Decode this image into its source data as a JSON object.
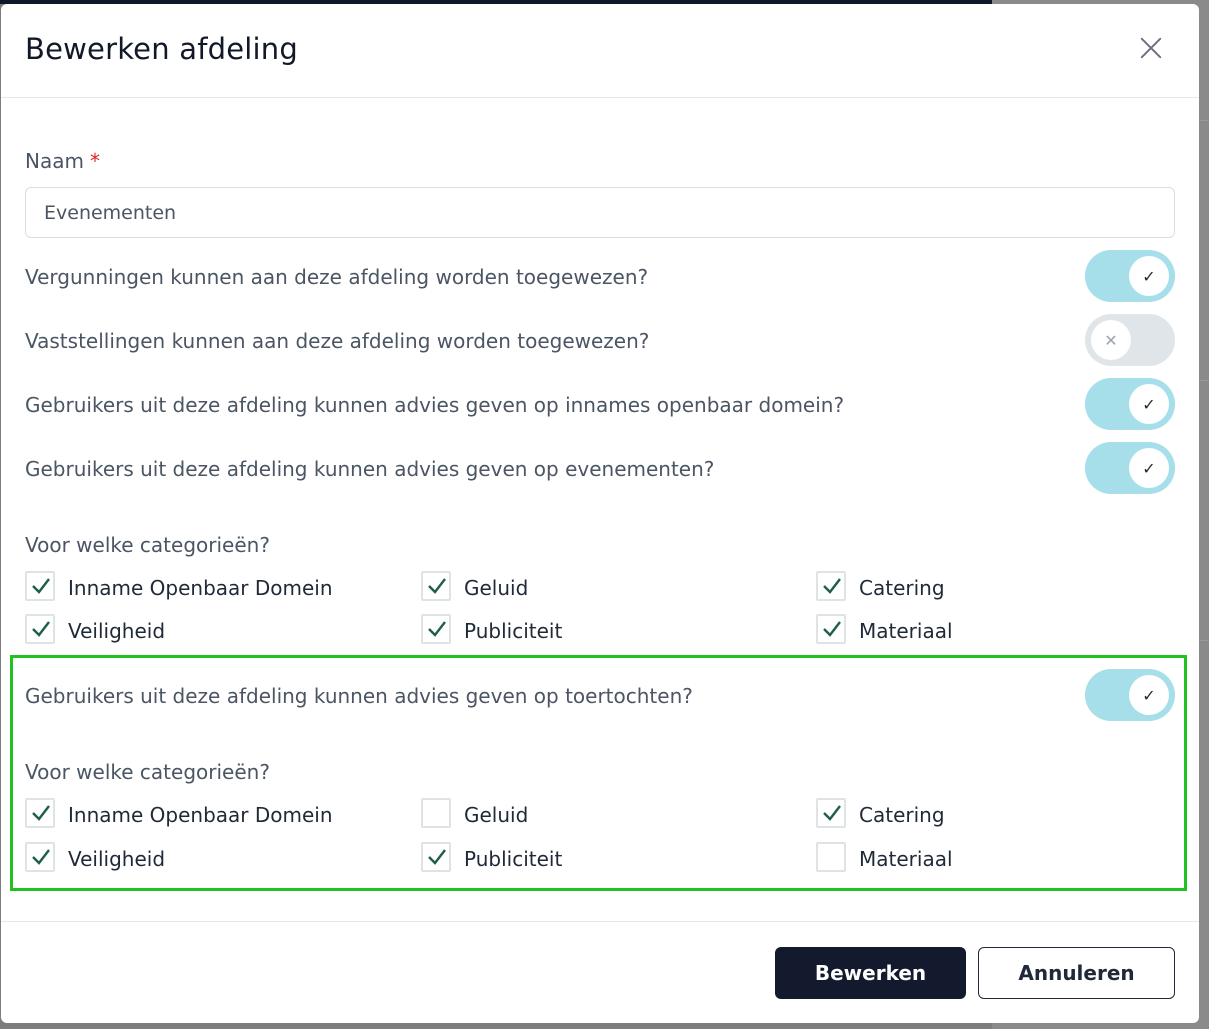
{
  "modal": {
    "title": "Bewerken afdeling"
  },
  "form": {
    "naam_label": "Naam",
    "required_marker": "*",
    "naam_value": "Evenementen",
    "toggles": [
      {
        "label": "Vergunningen kunnen aan deze afdeling worden toegewezen?",
        "state": "on"
      },
      {
        "label": "Vaststellingen kunnen aan deze afdeling worden toegewezen?",
        "state": "off"
      },
      {
        "label": "Gebruikers uit deze afdeling kunnen advies geven op innames openbaar domein?",
        "state": "on"
      },
      {
        "label": "Gebruikers uit deze afdeling kunnen advies geven op evenementen?",
        "state": "on"
      }
    ],
    "evenementen_categories": {
      "heading": "Voor welke categorieën?",
      "items": [
        {
          "label": "Inname Openbaar Domein",
          "checked": true
        },
        {
          "label": "Geluid",
          "checked": true
        },
        {
          "label": "Catering",
          "checked": true
        },
        {
          "label": "Veiligheid",
          "checked": true
        },
        {
          "label": "Publiciteit",
          "checked": true
        },
        {
          "label": "Materiaal",
          "checked": true
        }
      ]
    },
    "toertochten": {
      "label": "Gebruikers uit deze afdeling kunnen advies geven op toertochten?",
      "state": "on",
      "heading": "Voor welke categorieën?",
      "items": [
        {
          "label": "Inname Openbaar Domein",
          "checked": true
        },
        {
          "label": "Geluid",
          "checked": false
        },
        {
          "label": "Catering",
          "checked": true
        },
        {
          "label": "Veiligheid",
          "checked": true
        },
        {
          "label": "Publiciteit",
          "checked": true
        },
        {
          "label": "Materiaal",
          "checked": false
        }
      ]
    }
  },
  "footer": {
    "primary_label": "Bewerken",
    "secondary_label": "Annuleren"
  },
  "icons": {
    "close": "close-icon",
    "toggle_on": "check-icon",
    "toggle_off": "x-icon",
    "checkbox_tick": "checkmark-icon"
  },
  "colors": {
    "toggle_on": "#a6dfe9",
    "toggle_off": "#dfe5e8",
    "checkmark": "#1f5e4a",
    "primary_button": "#141a2e",
    "highlight_border": "#1fc21f",
    "required": "#dc2626"
  }
}
